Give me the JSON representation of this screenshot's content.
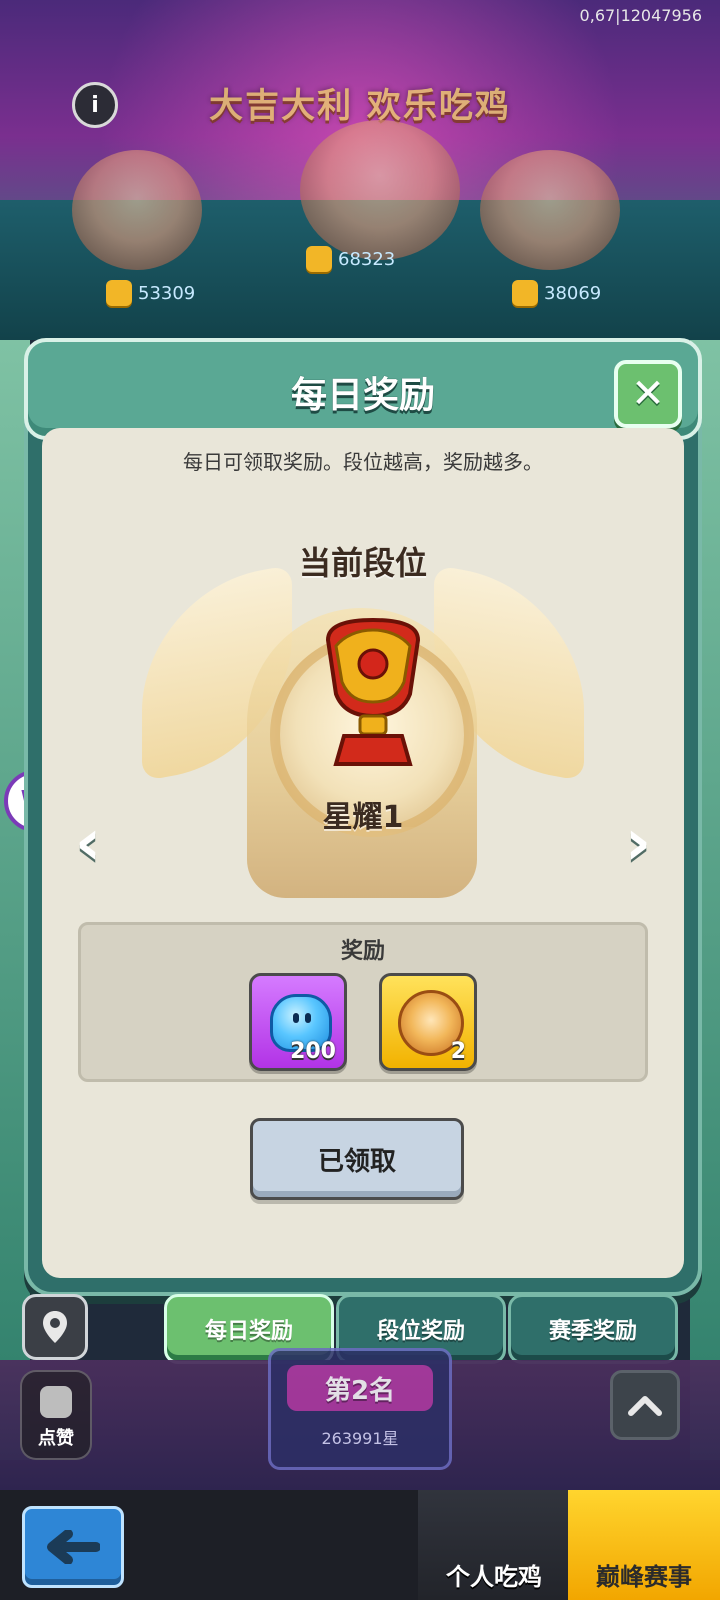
{
  "top_stat": "0,67|12047956",
  "banner_text": "大吉大利 欢乐吃鸡",
  "likes": [
    "53309",
    "68323",
    "38069"
  ],
  "modal": {
    "title": "每日奖励",
    "description": "每日可领取奖励。段位越高，奖励越多。",
    "current_rank_label": "当前段位",
    "rank_name": "星耀1",
    "reward_title": "奖励",
    "rewards": [
      {
        "icon": "blue-ghost-icon",
        "count": "200"
      },
      {
        "icon": "lion-head-icon",
        "count": "2"
      }
    ],
    "claimed_button": "已领取"
  },
  "tabs": [
    "每日奖励",
    "段位奖励",
    "赛季奖励"
  ],
  "bottom": {
    "rank_badge_title": "第2名",
    "rank_badge_sub": "263991星",
    "like_label": "点赞",
    "mode_personal": "个人吃鸡",
    "mode_peak": "巅峰赛事"
  }
}
